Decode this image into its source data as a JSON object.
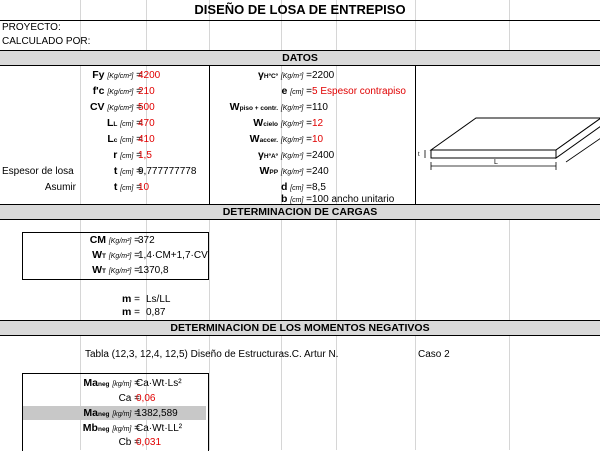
{
  "title": "DISEÑO DE LOSA DE ENTREPISO",
  "header": {
    "proyecto": "PROYECTO:",
    "calculado": "CALCULADO POR:"
  },
  "sections": {
    "datos": "DATOS",
    "cargas": "DETERMINACION DE CARGAS",
    "momentos": "DETERMINACION DE LOS MOMENTOS NEGATIVOS"
  },
  "datos_left": [
    {
      "sym": "Fy",
      "unit": "[Kg/cm²]",
      "val": "4200",
      "red": true
    },
    {
      "sym": "f'c",
      "unit": "[Kg/cm²]",
      "val": "210",
      "red": true
    },
    {
      "sym": "CV",
      "unit": "[Kg/cm²]",
      "val": "500",
      "red": true
    },
    {
      "sym": "L",
      "sub": "L",
      "unit": "[cm]",
      "val": "470",
      "red": true
    },
    {
      "sym": "L",
      "sub": "c",
      "unit": "[cm]",
      "val": "410",
      "red": true
    },
    {
      "sym": "r",
      "unit": "[cm]",
      "val": "1,5",
      "red": true
    },
    {
      "label": "Espesor de losa",
      "sym": "t",
      "unit": "[cm]",
      "val": "9,777777778",
      "red": false
    },
    {
      "label": "Asumir",
      "sym": "t",
      "unit": "[cm]",
      "val": "10",
      "red": true
    }
  ],
  "datos_right": [
    {
      "sym": "γ",
      "sub": "HºCº",
      "unit": "[Kg/m³]",
      "val": "2200",
      "red": false,
      "extra": ""
    },
    {
      "sym": "e",
      "unit": "[cm]",
      "val": "5",
      "red": true,
      "extra": "Espesor contrapiso"
    },
    {
      "sym": "W",
      "sub": "piso + contr.",
      "unit": "[Kg/m²]",
      "val": "110",
      "red": false,
      "extra": ""
    },
    {
      "sym": "W",
      "sub": "cielo",
      "unit": "[Kg/m²]",
      "val": "12",
      "red": true,
      "extra": ""
    },
    {
      "sym": "W",
      "sub": "accer.",
      "unit": "[Kg/m²]",
      "val": "10",
      "red": true,
      "extra": ""
    },
    {
      "sym": "γ",
      "sub": "HºAº",
      "unit": "[Kg/m³]",
      "val": "2400",
      "red": false,
      "extra": ""
    },
    {
      "sym": "W",
      "sub": "PP",
      "unit": "[Kg/m²]",
      "val": "240",
      "red": false,
      "extra": ""
    },
    {
      "sym": "d",
      "unit": "[cm]",
      "val": "8,5",
      "red": false,
      "extra": ""
    },
    {
      "sym": "b",
      "unit": "[cm]",
      "val": "100",
      "red": false,
      "extra": "ancho unitario"
    }
  ],
  "diagram": {
    "label_L": "L",
    "label_t": "t"
  },
  "cargas": [
    {
      "sym": "CM",
      "unit": "[Kg/m²]",
      "val": "372"
    },
    {
      "sym": "W",
      "sub": "T",
      "unit": "[Kg/m²]",
      "val": "1,4·CM+1,7·CV"
    },
    {
      "sym": "W",
      "sub": "T",
      "unit": "[Kg/m²]",
      "val": "1370,8"
    }
  ],
  "m_rows": [
    {
      "sym": "m",
      "val": "Ls/LL"
    },
    {
      "sym": "m",
      "val": "0,87"
    }
  ],
  "tabla_ref": "Tabla (12,3, 12,4, 12,5) Diseño de Estructuras.C. Artur N.",
  "caso": "Caso 2",
  "momentos": [
    {
      "sym": "Ma",
      "sub": "neg",
      "unit": "[kg/m]",
      "val": "Ca·Wt·Ls²",
      "red": false,
      "hl": false
    },
    {
      "sym": "Ca",
      "unit": "",
      "val": "0,06",
      "red": true,
      "hl": false
    },
    {
      "sym": "Ma",
      "sub": "neg",
      "unit": "[kg/m]",
      "val": "1382,589",
      "red": false,
      "hl": true
    },
    {
      "sym": "Mb",
      "sub": "neg",
      "unit": "[kg/m]",
      "val": "Ca·Wt·LL²",
      "red": false,
      "hl": false
    },
    {
      "sym": "Cb",
      "unit": "",
      "val": "0,031",
      "red": true,
      "hl": false
    }
  ]
}
